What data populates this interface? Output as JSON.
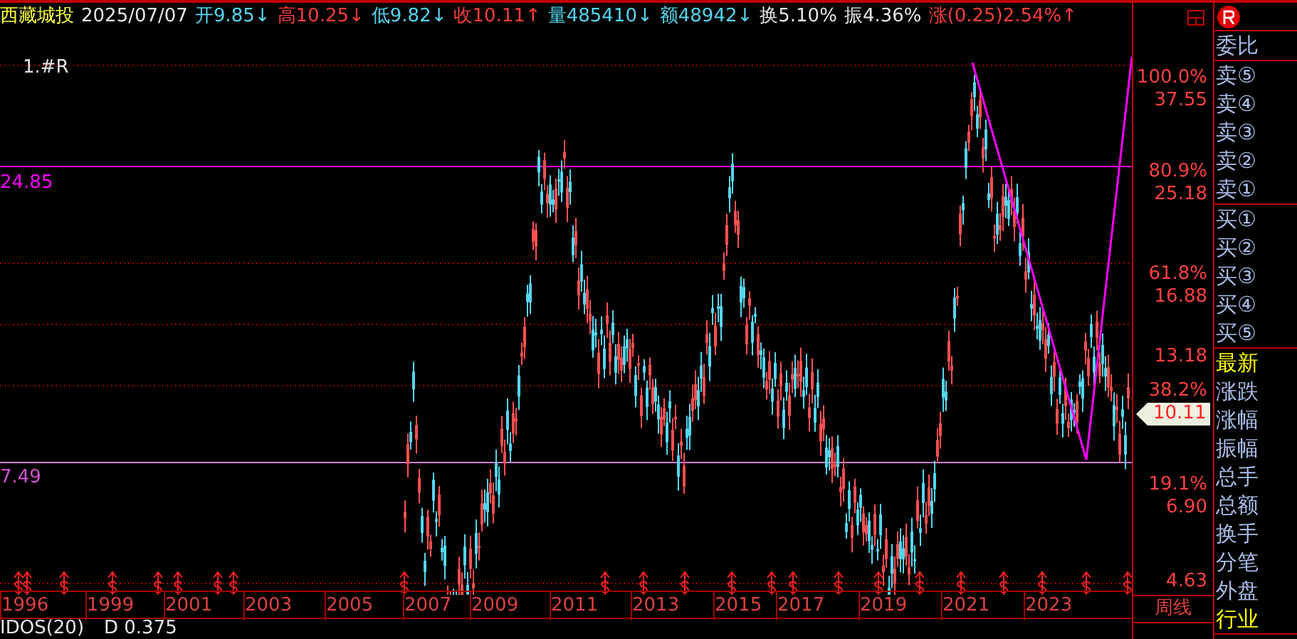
{
  "header": {
    "name": "西藏城投",
    "date": "2025/07/07",
    "quotes": [
      {
        "label": "开",
        "value": "9.85↓",
        "color": "#55d6f0"
      },
      {
        "label": "高",
        "value": "10.25↓",
        "color": "#ff3c3c"
      },
      {
        "label": "低",
        "value": "9.82↓",
        "color": "#55d6f0"
      },
      {
        "label": "收",
        "value": "10.11↑",
        "color": "#ff3c3c"
      },
      {
        "label": "量",
        "value": "485410↓",
        "color": "#55d6f0"
      },
      {
        "label": "额",
        "value": "48942↓",
        "color": "#55d6f0"
      },
      {
        "label": "换",
        "value": "5.10%",
        "color": "#e6e6e6"
      },
      {
        "label": "振",
        "value": "4.36%",
        "color": "#e6e6e6"
      },
      {
        "label": "涨",
        "value": "(0.25)2.54%↑",
        "color": "#ff3c3c"
      }
    ]
  },
  "chart": {
    "title": "1.#R",
    "left_labels": [
      "24.85",
      "7.49"
    ],
    "price_axis": [
      "100.0%",
      "37.55",
      "80.9%",
      "25.18",
      "61.8%",
      "16.88",
      "13.18",
      "38.2%",
      "19.1%",
      "6.90",
      "4.63"
    ],
    "last_price": "10.11",
    "period": "周线",
    "years": [
      "1996",
      "1999",
      "2001",
      "2003",
      "2005",
      "2007",
      "2009",
      "2011",
      "2013",
      "2015",
      "2017",
      "2019",
      "2021",
      "2023"
    ]
  },
  "sidebar": {
    "groups": [
      [
        {
          "text": "委比",
          "kind": "normal"
        }
      ],
      [
        {
          "text": "卖⑤",
          "kind": "normal"
        },
        {
          "text": "卖④",
          "kind": "normal"
        },
        {
          "text": "卖③",
          "kind": "normal"
        },
        {
          "text": "卖②",
          "kind": "normal"
        },
        {
          "text": "卖①",
          "kind": "normal"
        }
      ],
      [
        {
          "text": "买①",
          "kind": "normal"
        },
        {
          "text": "买②",
          "kind": "normal"
        },
        {
          "text": "买③",
          "kind": "normal"
        },
        {
          "text": "买④",
          "kind": "normal"
        },
        {
          "text": "买⑤",
          "kind": "normal"
        }
      ],
      [
        {
          "text": "最新",
          "kind": "highlight"
        },
        {
          "text": "涨跌",
          "kind": "normal"
        },
        {
          "text": "涨幅",
          "kind": "normal"
        },
        {
          "text": "振幅",
          "kind": "normal"
        },
        {
          "text": "总手",
          "kind": "normal"
        },
        {
          "text": "总额",
          "kind": "normal"
        },
        {
          "text": "换手",
          "kind": "normal"
        },
        {
          "text": "分笔",
          "kind": "normal"
        },
        {
          "text": "外盘",
          "kind": "normal"
        },
        {
          "text": "行业",
          "kind": "highlight"
        }
      ]
    ]
  },
  "indicator": {
    "name": "IDOS(20)",
    "value": "D 0.375"
  }
}
